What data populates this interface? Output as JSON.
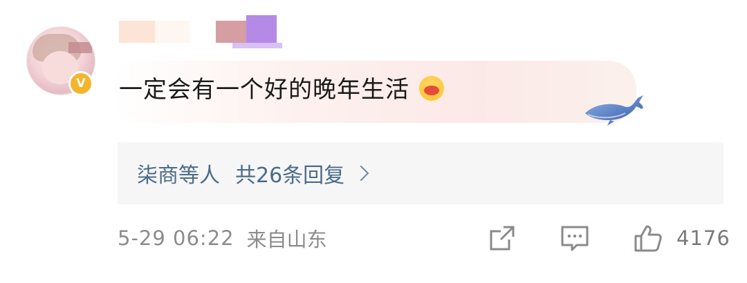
{
  "comment": {
    "text": "一定会有一个好的晚年生活",
    "emoji": "hugging-face-emoji"
  },
  "user": {
    "verified_badge": "V"
  },
  "replies": {
    "names": "柒商等人",
    "count_text": "共26条回复",
    "chevron": "chevron-right-icon"
  },
  "meta": {
    "time": "5-29 06:22",
    "source": "来自山东"
  },
  "actions": {
    "share_icon": "share-icon",
    "comment_icon": "comment-icon",
    "like_icon": "thumbs-up-icon",
    "like_count": "4176"
  },
  "colors": {
    "link": "#4b6b8a",
    "muted": "#8c8c8c",
    "badge": "#f5b52a"
  }
}
